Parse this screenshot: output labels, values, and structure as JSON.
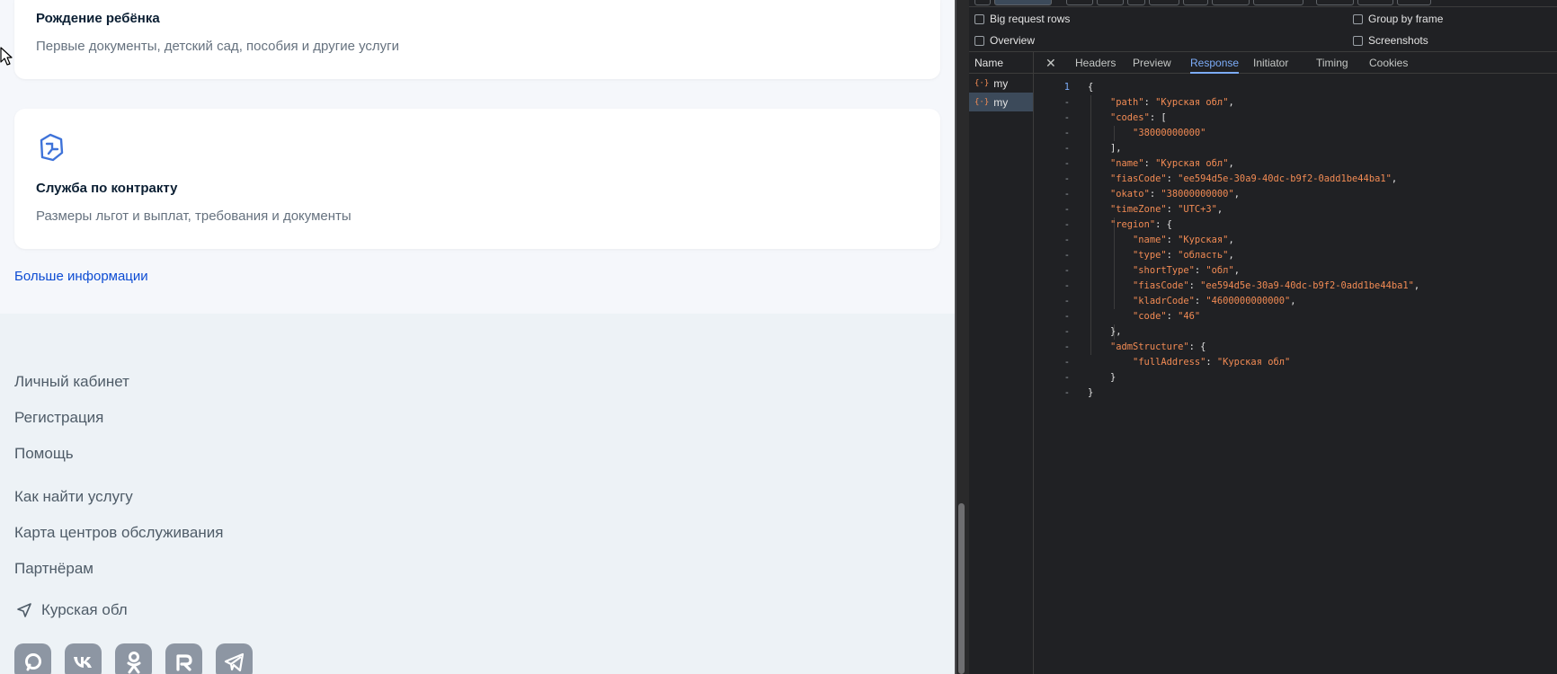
{
  "site": {
    "cards": [
      {
        "title": "Рождение ребёнка",
        "desc": "Первые документы, детский сад, пособия и другие услуги"
      },
      {
        "title": "Служба по контракту",
        "desc": "Размеры льгот и выплат, требования и документы"
      }
    ],
    "more_link": "Больше информации",
    "footer_links": [
      "Личный кабинет",
      "Регистрация",
      "Помощь",
      "Как найти услугу",
      "Карта центров обслуживания",
      "Партнёрам"
    ],
    "region": "Курская обл",
    "socials": [
      "max-icon",
      "vk-icon",
      "ok-icon",
      "rutube-icon",
      "telegram-icon"
    ]
  },
  "devtools": {
    "options": {
      "big_request_rows": "Big request rows",
      "overview": "Overview",
      "group_by_frame": "Group by frame",
      "screenshots": "Screenshots"
    },
    "name_header": "Name",
    "requests": [
      "my",
      "my"
    ],
    "tabs": [
      "Headers",
      "Preview",
      "Response",
      "Initiator",
      "Timing",
      "Cookies"
    ],
    "active_tab": "Response",
    "response": {
      "path": "Курская обл",
      "code_0": "38000000000",
      "name": "Курская обл",
      "fiasCode": "ee594d5e-30a9-40dc-b9f2-0add1be44ba1",
      "okato": "38000000000",
      "timeZone": "UTC+3",
      "region_name": "Курская",
      "region_type": "область",
      "region_shortType": "обл",
      "region_fiasCode": "ee594d5e-30a9-40dc-b9f2-0add1be44ba1",
      "region_kladrCode": "4600000000000",
      "region_code": "46",
      "adm_fullAddress": "Курская обл"
    },
    "colors": {
      "accent": "#7cacf8",
      "json_key": "#f28b54",
      "link": "#0d4cd3"
    }
  }
}
